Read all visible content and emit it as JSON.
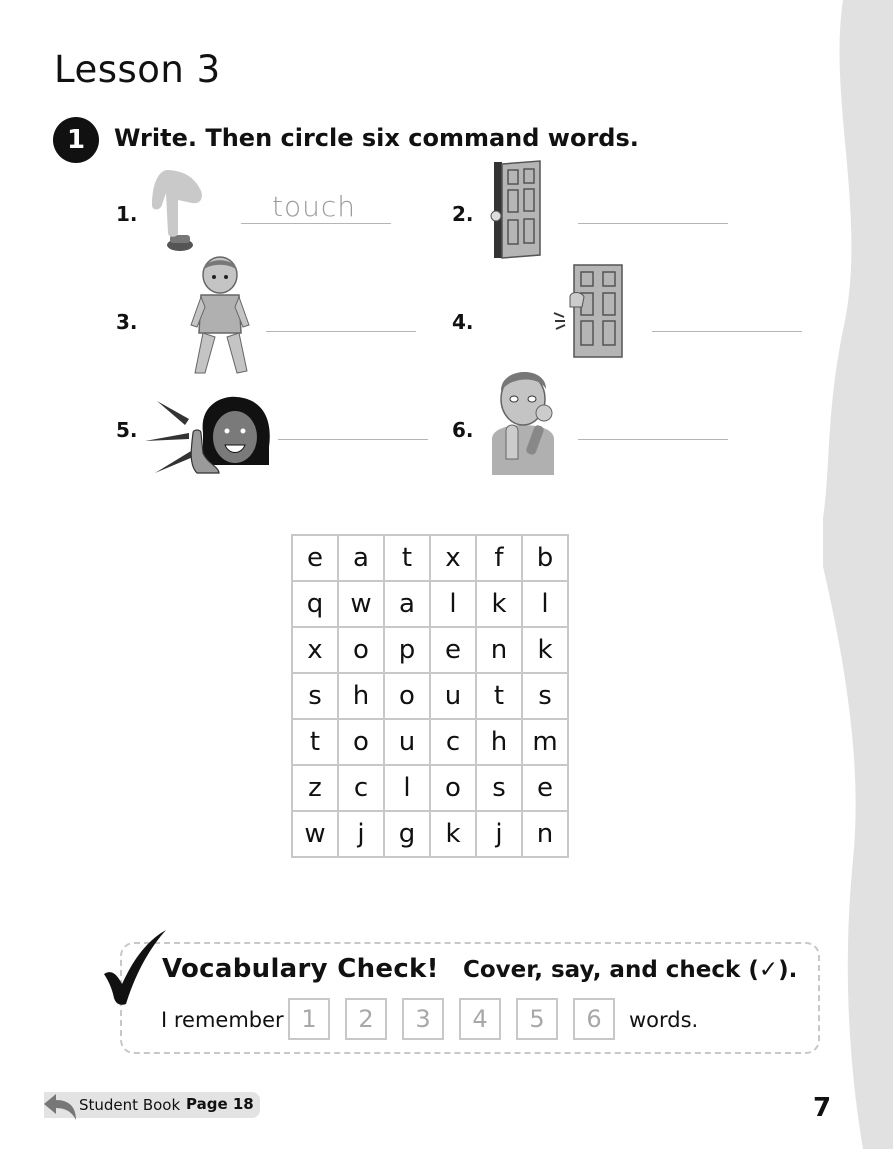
{
  "lesson": {
    "title": "Lesson 3"
  },
  "activity": {
    "number": "1",
    "instruction": "Write. Then circle six command words."
  },
  "items": [
    {
      "number": "1.",
      "answer": "touch",
      "icon": "finger-pressing-button-icon"
    },
    {
      "number": "2.",
      "answer": "",
      "icon": "open-door-icon"
    },
    {
      "number": "3.",
      "answer": "",
      "icon": "walking-boy-icon"
    },
    {
      "number": "4.",
      "answer": "",
      "icon": "knocking-door-icon"
    },
    {
      "number": "5.",
      "answer": "",
      "icon": "shouting-girl-icon"
    },
    {
      "number": "6.",
      "answer": "",
      "icon": "eating-boy-icon"
    }
  ],
  "word_search": {
    "rows": [
      [
        "e",
        "a",
        "t",
        "x",
        "f",
        "b"
      ],
      [
        "q",
        "w",
        "a",
        "l",
        "k",
        "l"
      ],
      [
        "x",
        "o",
        "p",
        "e",
        "n",
        "k"
      ],
      [
        "s",
        "h",
        "o",
        "u",
        "t",
        "s"
      ],
      [
        "t",
        "o",
        "u",
        "c",
        "h",
        "m"
      ],
      [
        "z",
        "c",
        "l",
        "o",
        "s",
        "e"
      ],
      [
        "w",
        "j",
        "g",
        "k",
        "j",
        "n"
      ]
    ]
  },
  "vocab_check": {
    "title": "Vocabulary Check!",
    "subtitle": "Cover, say, and check (✓).",
    "prefix": "I remember",
    "numbers": [
      "1",
      "2",
      "3",
      "4",
      "5",
      "6"
    ],
    "suffix": "words."
  },
  "footer": {
    "student_book": "Student Book",
    "page_ref": "Page 18",
    "page_number": "7"
  },
  "colors": {
    "accent_gray": "#c8c8c8",
    "wave_gray": "#e1e1e1"
  }
}
